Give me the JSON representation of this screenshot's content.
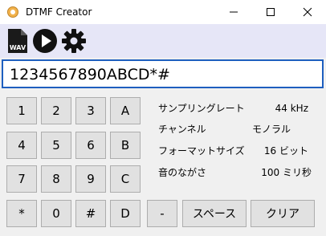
{
  "window": {
    "title": "DTMF Creator"
  },
  "toolbar": {
    "wav_icon_label": "WAV",
    "icons": [
      "wav-file-icon",
      "play-icon",
      "gear-icon"
    ]
  },
  "dial": {
    "value": "1234567890ABCD*#"
  },
  "keypad": {
    "keys": [
      "1",
      "2",
      "3",
      "A",
      "4",
      "5",
      "6",
      "B",
      "7",
      "8",
      "9",
      "C",
      "*",
      "0",
      "#",
      "D"
    ],
    "dash": "-",
    "space": "スペース",
    "clear": "クリア"
  },
  "info": {
    "sample_rate_label": "サンプリングレート",
    "sample_rate_value": "44 kHz",
    "channel_label": "チャンネル",
    "channel_value": "モノラル",
    "format_label": "フォーマットサイズ",
    "format_value": "16 ビット",
    "duration_label": "音のながさ",
    "duration_value": "100 ミリ秒"
  },
  "colors": {
    "toolbar_bg": "#e6e6f7",
    "input_border": "#1e5fbf",
    "button_bg": "#e1e1e1"
  }
}
